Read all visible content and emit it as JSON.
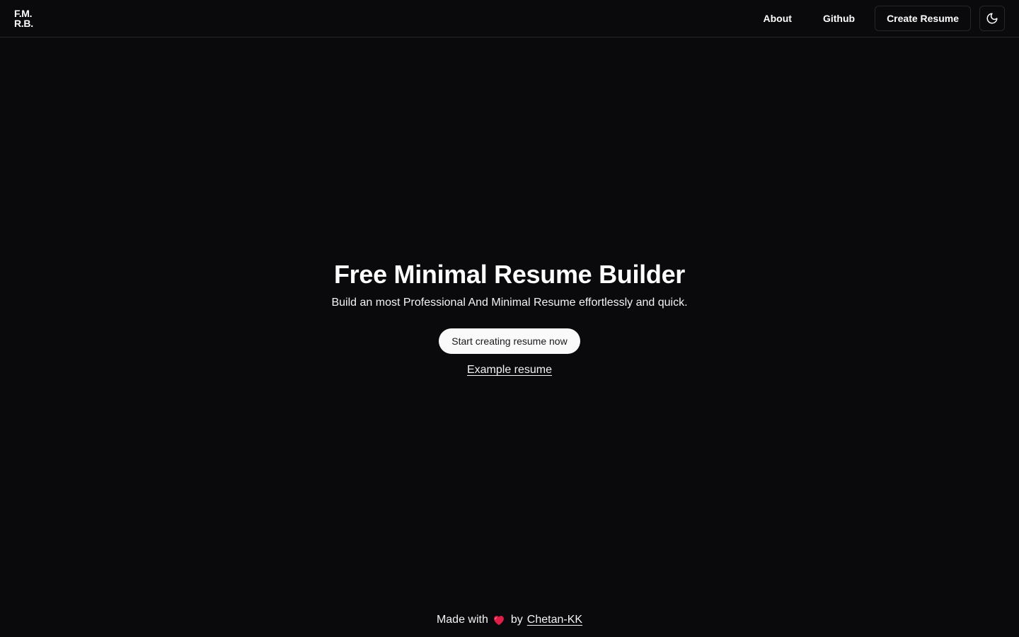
{
  "header": {
    "logo_line1": "F.M.",
    "logo_line2": "R.B.",
    "nav": {
      "about": "About",
      "github": "Github",
      "create_resume": "Create Resume"
    },
    "theme_toggle_icon": "moon-icon"
  },
  "hero": {
    "title": "Free Minimal Resume Builder",
    "subtitle": "Build an most Professional And Minimal Resume effortlessly and quick.",
    "cta_label": "Start creating resume now",
    "example_link": "Example resume"
  },
  "footer": {
    "made_with": "Made with",
    "heart_icon": "heart-icon",
    "by": "by",
    "author": "Chetan-KK"
  },
  "colors": {
    "background": "#0a0a0c",
    "border": "#27272a",
    "text": "#fafafa",
    "cta_bg": "#fafafa",
    "cta_text": "#18181b",
    "heart": "#e11d48"
  }
}
